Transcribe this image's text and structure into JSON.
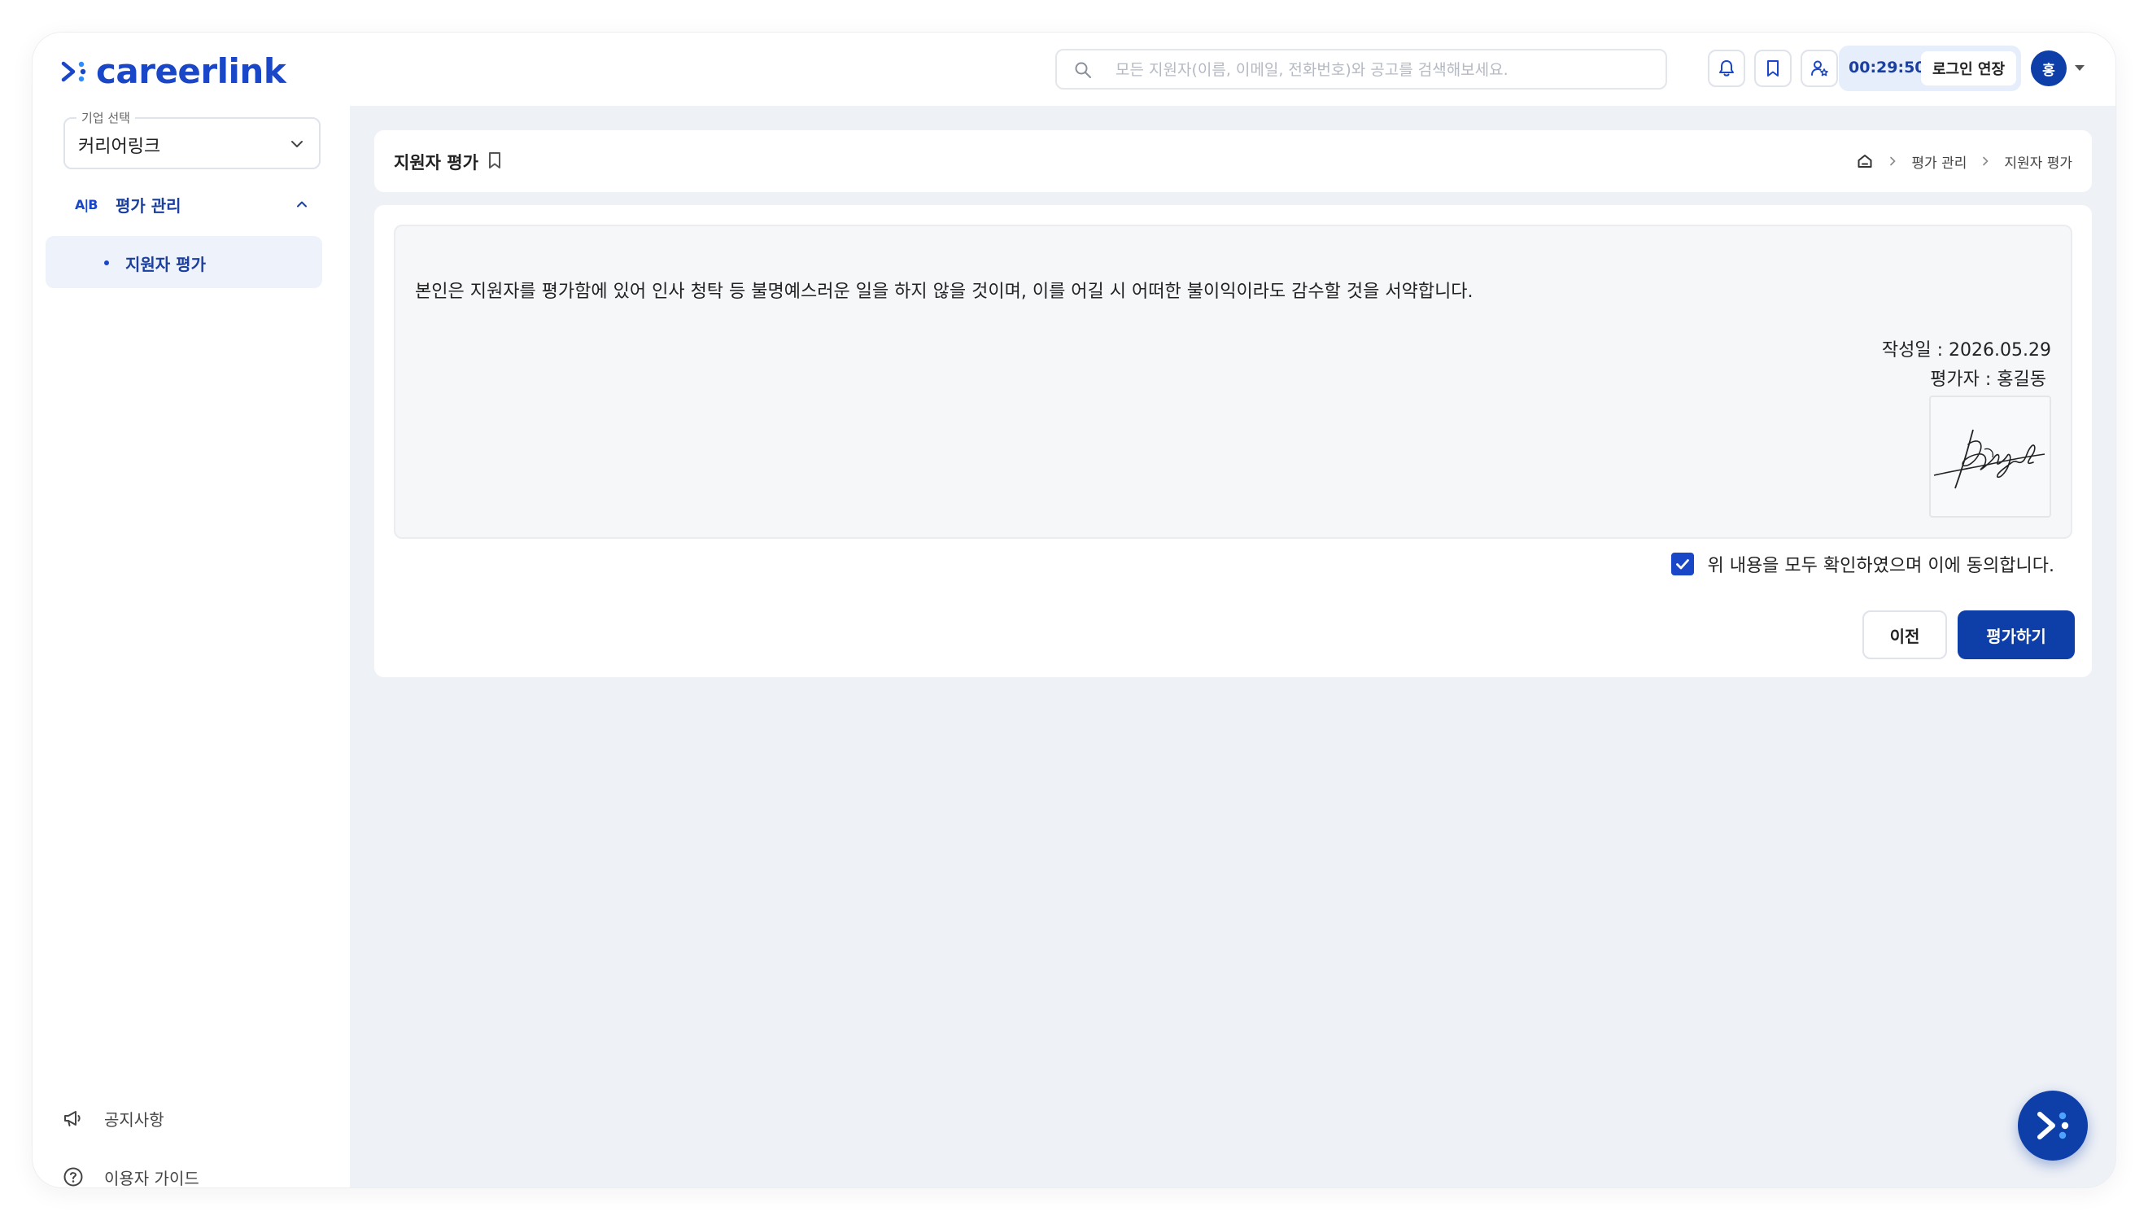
{
  "brand": {
    "logo_text": "careerlink",
    "color": "#1a47c7"
  },
  "header": {
    "search_placeholder": "모든 지원자(이름, 이메일, 전화번호)와 공고를 검색해보세요.",
    "icons": [
      "bell-icon",
      "bookmark-icon",
      "user-star-icon"
    ],
    "session_timer": "00:29:50",
    "extend_login_label": "로그인 연장",
    "avatar_initial": "홍"
  },
  "sidebar": {
    "company_select_label": "기업 선택",
    "company_select_value": "커리어링크",
    "menu_group": {
      "icon_text": "A|B",
      "label": "평가 관리"
    },
    "submenu_item": "지원자 평가",
    "bottom_links": [
      {
        "icon": "megaphone-icon",
        "label": "공지사항"
      },
      {
        "icon": "help-circle-icon",
        "label": "이용자 가이드"
      }
    ]
  },
  "page": {
    "title": "지원자 평가",
    "breadcrumb": [
      "평가 관리",
      "지원자 평가"
    ]
  },
  "pledge": {
    "text": "본인은 지원자를 평가함에 있어 인사 청탁 등 불명예스러운 일을 하지 않을 것이며, 이를 어길 시 어떠한 불이익이라도 감수할 것을 서약합니다.",
    "written_date": "작성일 : 2026.05.29",
    "evaluator": "평가자 : 홍길동",
    "agree_label": "위 내용을 모두 확인하였으며 이에 동의합니다.",
    "agreed": true
  },
  "buttons": {
    "prev": "이전",
    "evaluate": "평가하기"
  },
  "colors": {
    "primary": "#0e3fa8",
    "accent": "#1a47c7",
    "background": "#eef1f6"
  }
}
